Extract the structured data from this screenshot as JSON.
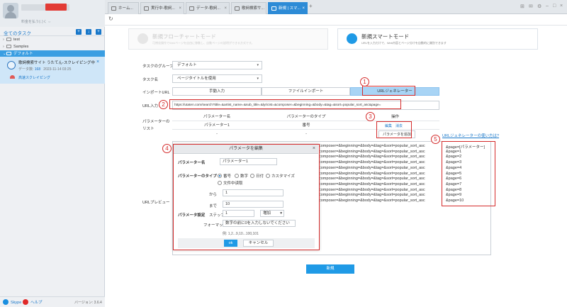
{
  "sidebar": {
    "user_badge": "",
    "user_desc": "料金を払う(↓)く ⇔",
    "all_tasks": "全てのタスク",
    "tree": [
      "test",
      "Samples",
      "デフォルト"
    ],
    "task": {
      "title": "歌詞検索サイト うたてん-スクレイピング中",
      "data_label": "データ数:",
      "data_count": "168",
      "date": "2023-11-14 03:25",
      "sub": "高速スクレイピング"
    },
    "footer": {
      "skype": "Skype",
      "help": "ヘルプ",
      "version": "バージョン: 3.6.4"
    }
  },
  "tabs": [
    {
      "label": "ホーム..."
    },
    {
      "label": "実行中-歌詞..."
    },
    {
      "label": "データ-歌詞..."
    },
    {
      "label": "歌詞検索サ..."
    },
    {
      "label": "新規 | スマ..."
    }
  ],
  "modes": {
    "flow": {
      "title": "新規フローチャートモード",
      "desc": "可視化操作でWebページを自由に移動し、自動ページの説明ができる方式です。"
    },
    "smart": {
      "title": "新規スマートモード",
      "desc": "URLを入力だけで、Web内容とページ分けを自動的に識別できます"
    }
  },
  "form": {
    "group_label": "タスクのグループ",
    "group_value": "デフォルト",
    "name_label": "タスク名",
    "name_value": "ページタイトルを使用",
    "input_label": "インポートURL",
    "seg_manual": "手動入力",
    "seg_file": "ファイルインポート",
    "seg_gen": "URLジェネレーター",
    "url_label": "URL入力",
    "url_value": "https://utaten.com/search?title=&artist_name=&sub_title=&lyricist=&composer=&beginning=&body=&tag=&sort=popular_sort_asc&page=",
    "param_label": "パラメーターのリスト",
    "param_headers": [
      "パラメーター名",
      "パラメーターのタイプ",
      "操作"
    ],
    "param_row": [
      "パラメーター1",
      "番号"
    ],
    "param_actions": {
      "edit": "編集",
      "del": "消去",
      "add": "パラメータを追加"
    },
    "param_dash": [
      "-",
      "-"
    ],
    "help_link": "URLジェネレーターの使い方は?",
    "preview_label": "URLプレビュー",
    "new_button": "新規"
  },
  "preview_lines": [
    "composer=&beginning=&body=&tag=&sort=popular_sort_asc&page=[パラメーター]",
    "composer=&beginning=&body=&tag=&sort=popular_sort_asc&page=1",
    "composer=&beginning=&body=&tag=&sort=popular_sort_asc&page=2",
    "composer=&beginning=&body=&tag=&sort=popular_sort_asc&page=3",
    "composer=&beginning=&body=&tag=&sort=popular_sort_asc&page=4",
    "composer=&beginning=&body=&tag=&sort=popular_sort_asc&page=5",
    "composer=&beginning=&body=&tag=&sort=popular_sort_asc&page=6",
    "composer=&beginning=&body=&tag=&sort=popular_sort_asc&page=7",
    "composer=&beginning=&body=&tag=&sort=popular_sort_asc&page=8",
    "composer=&beginning=&body=&tag=&sort=popular_sort_asc&page=9",
    "composer=&beginning=&body=&tag=&sort=popular_sort_asc&page=10"
  ],
  "dialog": {
    "title": "パラメータを編集",
    "name_label": "パラメーター名",
    "name_value": "パラメーター1",
    "type_label": "パラメーターのタイプ",
    "types": [
      "番号",
      "数字",
      "日付",
      "カスタマイズ"
    ],
    "type_file": "文件中读取",
    "from_label": "から",
    "from_value": "1",
    "to_label": "まで",
    "to_value": "10",
    "settings_label": "パラメータ設定",
    "step_label": "ステップ",
    "step_value": "1",
    "step_mode": "増加",
    "format_label": "フォーマット",
    "format_value": "数字の前に0を入力しないでください",
    "example": "例: 1,2...9,10...100,101",
    "ok": "ok",
    "cancel": "キャンセル"
  },
  "markers": [
    "1",
    "2",
    "3",
    "4",
    "5"
  ],
  "colors": {
    "accent": "#1f9ae6",
    "annotation": "#d42a2a"
  }
}
